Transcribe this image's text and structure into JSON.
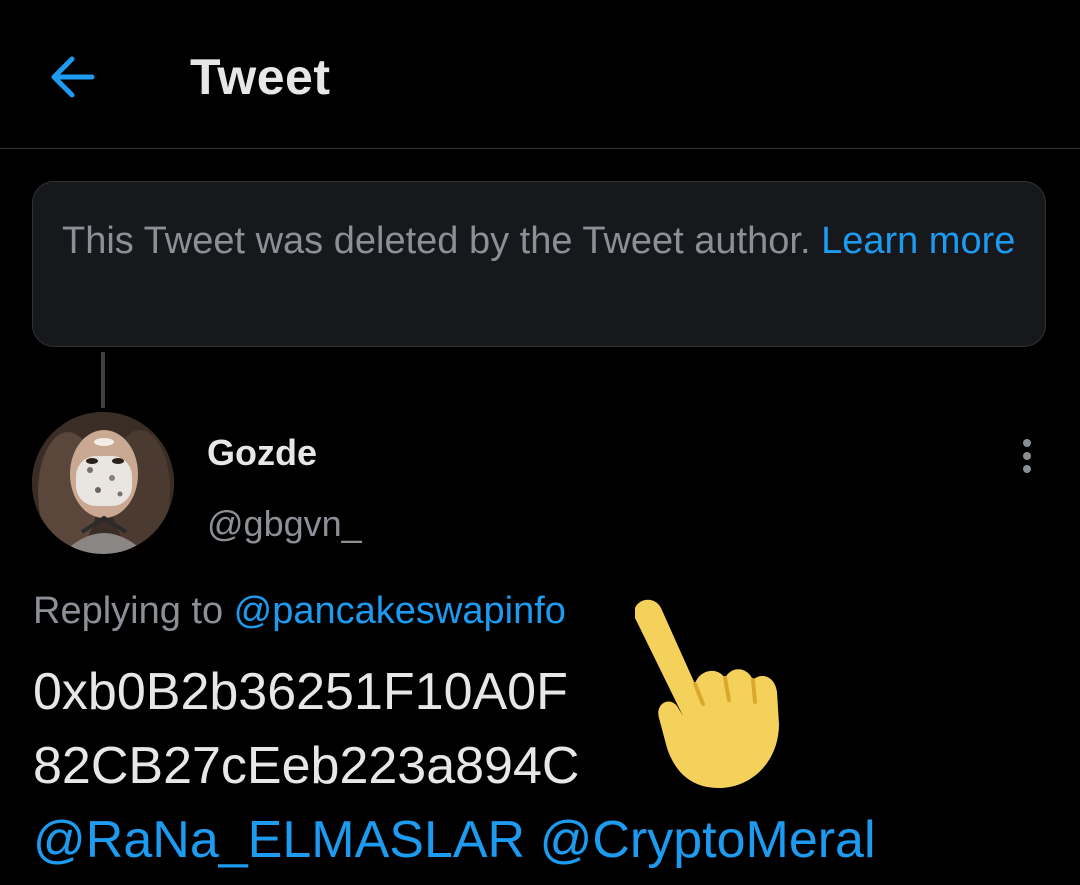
{
  "header": {
    "title": "Tweet",
    "back_icon": "arrow-left-icon"
  },
  "deleted_notice": {
    "text": "This Tweet was deleted by the Tweet author. ",
    "link_label": "Learn more"
  },
  "tweet": {
    "author_name": "Gozde",
    "author_handle": "@gbgvn_",
    "replying_prefix": "Replying to ",
    "replying_to": "@pancakeswapinfo",
    "line1": "0xb0B2b36251F10A0F",
    "line2": "82CB27cEeb223a894C",
    "mention1": "@RaNa_ELMASLAR",
    "mention2": "@CryptoMeral"
  },
  "colors": {
    "accent": "#1d9bf0",
    "background": "#000000",
    "card": "#16181c",
    "muted_text": "#8b9096",
    "emoji_yellow": "#f4d15b"
  }
}
